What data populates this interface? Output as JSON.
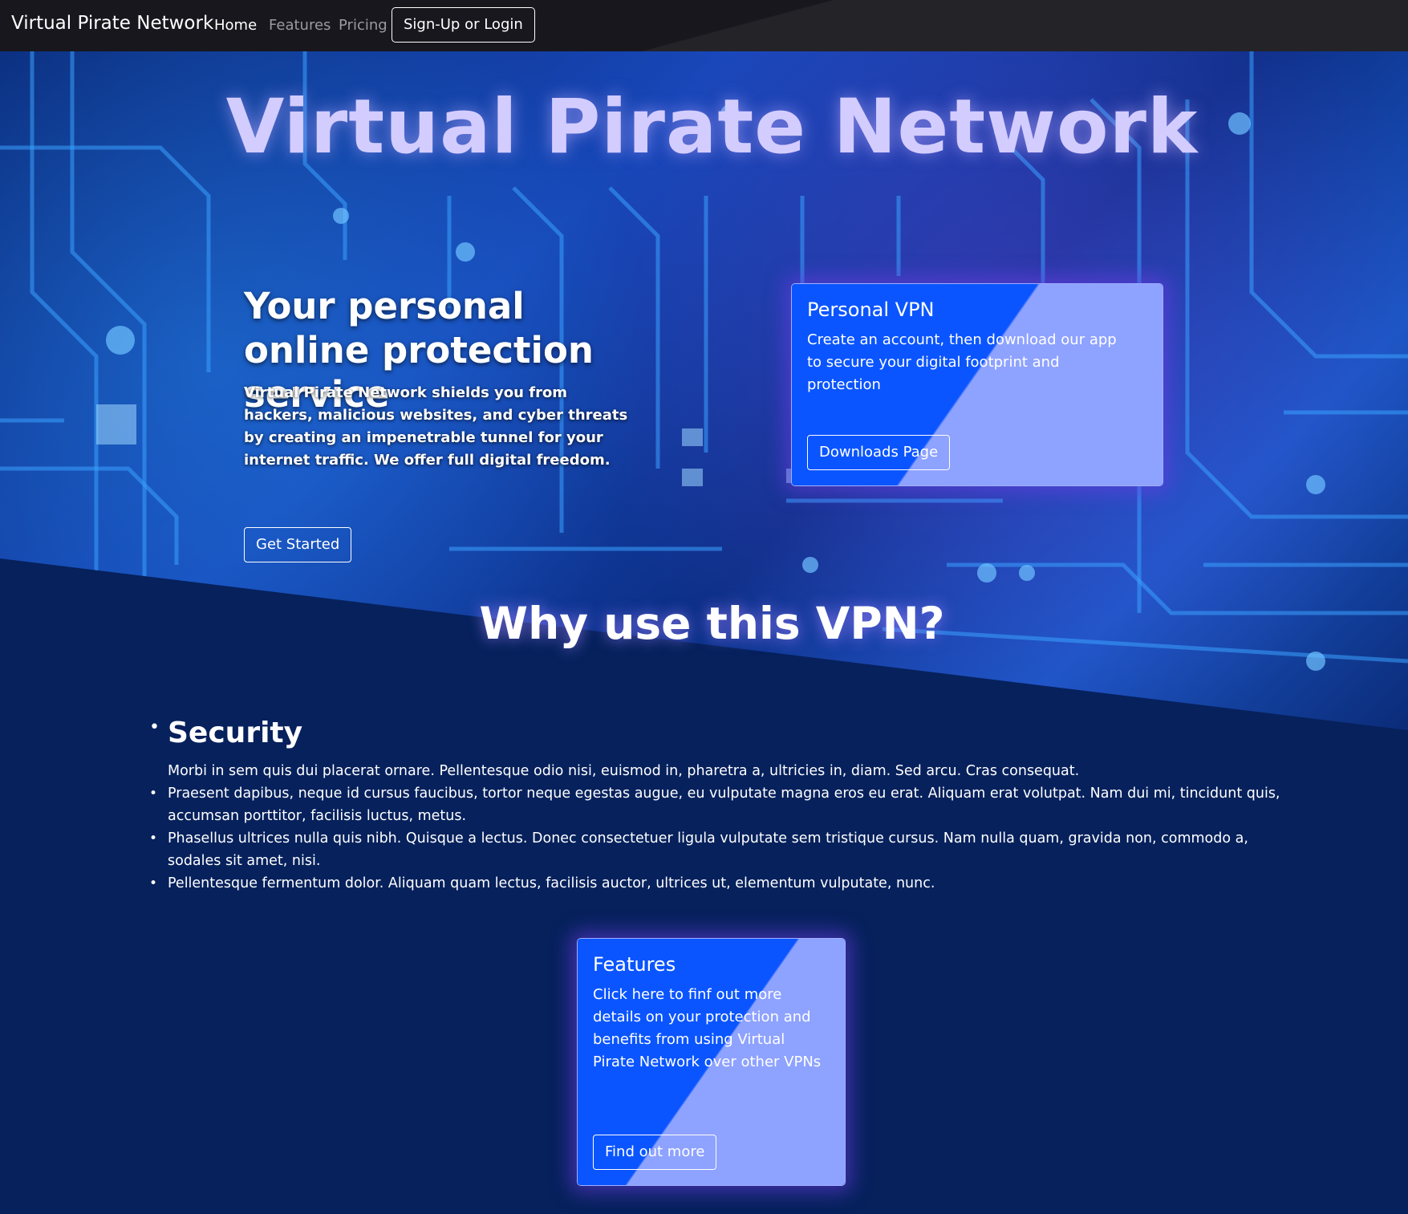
{
  "nav": {
    "brand": "Virtual Pirate Network",
    "home": "Home",
    "features": "Features",
    "pricing": "Pricing",
    "signup": "Sign-Up or Login"
  },
  "hero": {
    "title": "Virtual Pirate Network",
    "tagline": "Your personal online protection service",
    "lead": "Virtual Pirate Network shields you from hackers, malicious websites, and cyber threats by creating an impenetrable tunnel for your internet traffic. We offer full digital freedom.",
    "cta": "Get Started"
  },
  "vpn_card": {
    "title": "Personal VPN",
    "text": "Create an account, then download our app to secure your digital footprint and protection",
    "button": "Downloads Page"
  },
  "why": {
    "title": "Why use this VPN?",
    "security_heading": "Security",
    "intro": "Morbi in sem quis dui placerat ornare. Pellentesque odio nisi, euismod in, pharetra a, ultricies in, diam. Sed arcu. Cras consequat.",
    "bullets": [
      "Praesent dapibus, neque id cursus faucibus, tortor neque egestas augue, eu vulputate magna eros eu erat. Aliquam erat volutpat. Nam dui mi, tincidunt quis, accumsan porttitor, facilisis luctus, metus.",
      "Phasellus ultrices nulla quis nibh. Quisque a lectus. Donec consectetuer ligula vulputate sem tristique cursus. Nam nulla quam, gravida non, commodo a, sodales sit amet, nisi.",
      "Pellentesque fermentum dolor. Aliquam quam lectus, facilisis auctor, ultrices ut, elementum vulputate, nunc."
    ]
  },
  "features_card": {
    "title": "Features",
    "text": "Click here to finf out more details on your protection and benefits from using Virtual Pirate Network over other VPNs",
    "button": "Find out more"
  },
  "colors": {
    "navbar": "#232328",
    "page_bg": "#06215c",
    "card_blue": "#0a55ff",
    "card_lavender": "#8ea2ff",
    "title_lavender": "#d3ccff"
  },
  "icons": [
    "bullet-dot"
  ]
}
